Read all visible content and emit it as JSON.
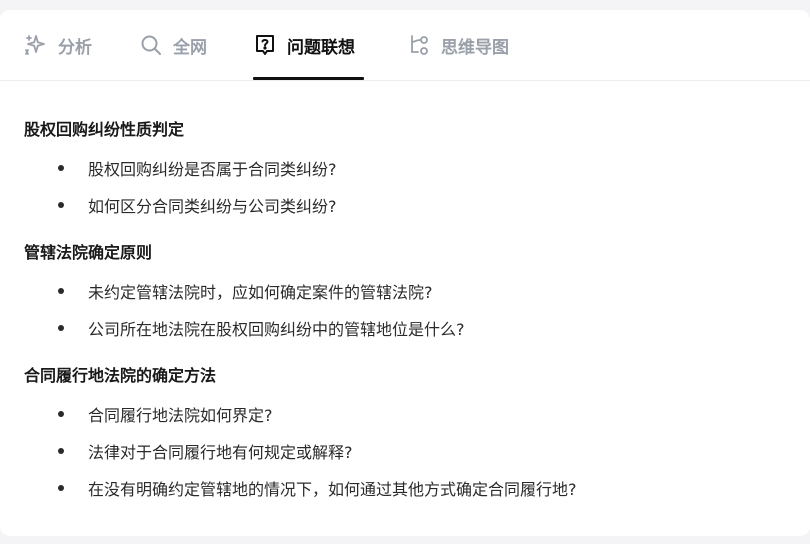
{
  "tabs": [
    {
      "label": "分析",
      "icon": "sparkle-icon"
    },
    {
      "label": "全网",
      "icon": "search-icon"
    },
    {
      "label": "问题联想",
      "icon": "question-bubble-icon",
      "active": true
    },
    {
      "label": "思维导图",
      "icon": "mindmap-icon"
    }
  ],
  "sections": [
    {
      "title": "股权回购纠纷性质判定",
      "items": [
        "股权回购纠纷是否属于合同类纠纷?",
        "如何区分合同类纠纷与公司类纠纷?"
      ]
    },
    {
      "title": "管辖法院确定原则",
      "items": [
        "未约定管辖法院时，应如何确定案件的管辖法院?",
        "公司所在地法院在股权回购纠纷中的管辖地位是什么?"
      ]
    },
    {
      "title": "合同履行地法院的确定方法",
      "items": [
        "合同履行地法院如何界定?",
        "法律对于合同履行地有何规定或解释?",
        "在没有明确约定管辖地的情况下，如何通过其他方式确定合同履行地?"
      ]
    }
  ],
  "colors": {
    "active_text": "#111111",
    "inactive_text": "#9aa0aa",
    "underline": "#111111"
  }
}
